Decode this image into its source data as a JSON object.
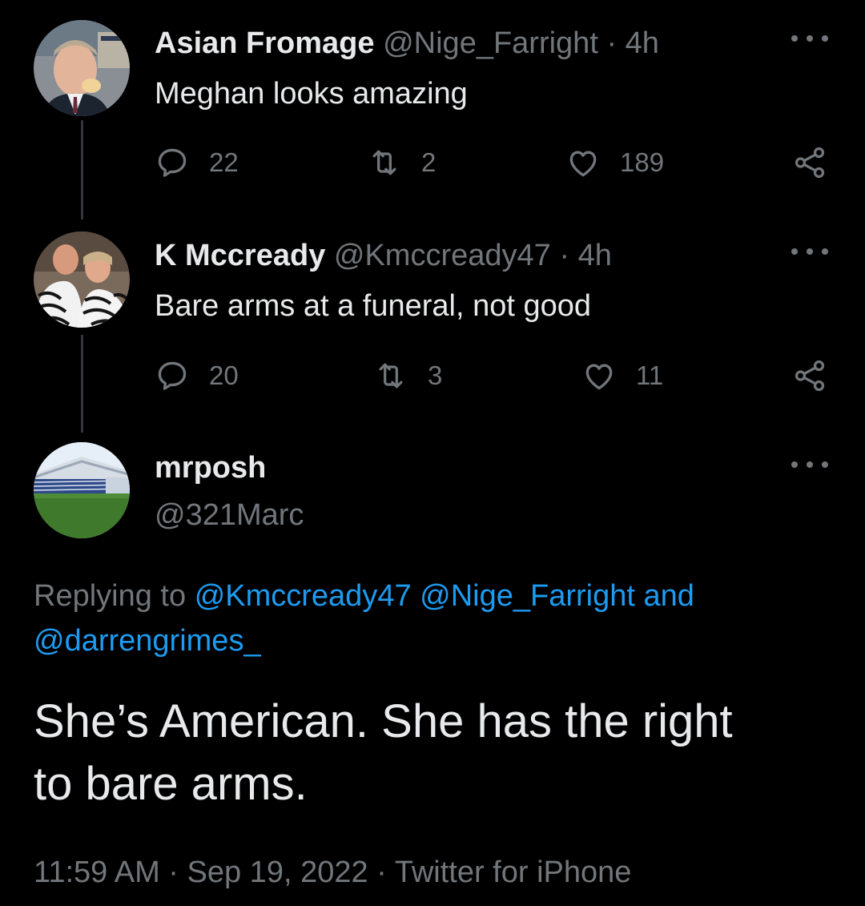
{
  "tweets": [
    {
      "display_name": "Asian Fromage",
      "handle": "@Nige_Farright",
      "time": "4h",
      "text": "Meghan looks amazing",
      "replies": "22",
      "retweets": "2",
      "likes": "189"
    },
    {
      "display_name": "K Mccready",
      "handle": "@Kmccready47",
      "time": "4h",
      "text": "Bare arms at a funeral, not good",
      "replies": "20",
      "retweets": "3",
      "likes": "11"
    }
  ],
  "main_tweet": {
    "display_name": "mrposh",
    "handle": "@321Marc",
    "replying_prefix": "Replying to",
    "replying_mention_1": "@Kmccready47",
    "replying_mention_2": "@Nige_Farright",
    "replying_and": "and",
    "replying_mention_3": "@darrengrimes_",
    "text_line_1": "She’s American. She has the right",
    "text_line_2": "to bare arms.",
    "time": "11:59 AM",
    "date": "Sep 19, 2022",
    "source": "Twitter for iPhone"
  },
  "separator_dot": "·",
  "icons": [
    "reply-icon",
    "retweet-icon",
    "like-icon",
    "share-icon",
    "more-icon"
  ],
  "colors": {
    "background": "#000000",
    "text": "#e7e9ea",
    "muted": "#71767b",
    "link": "#1d9bf0",
    "thread_line": "#333639"
  }
}
